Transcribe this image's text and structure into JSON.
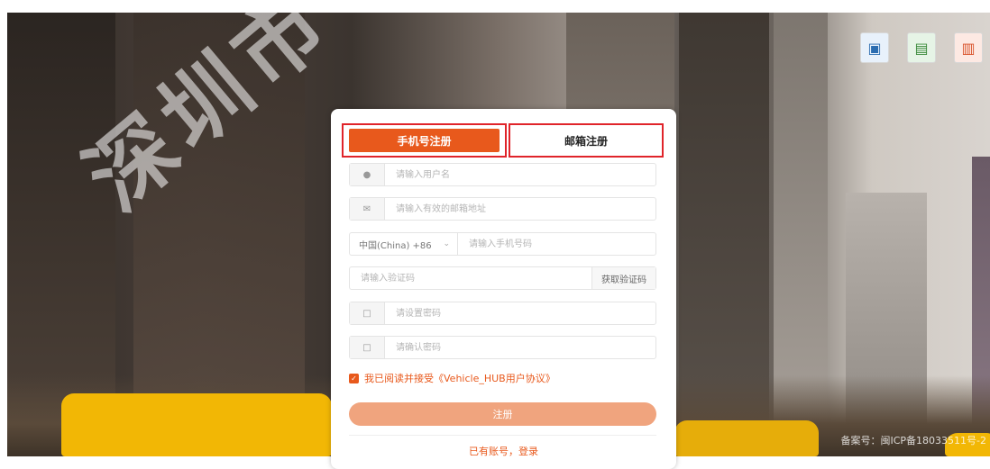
{
  "background": {
    "watermark": "深圳市",
    "footer_note": "备案号：闽ICP备18033511号-2"
  },
  "top_icons": [
    {
      "icon": "id-card-icon"
    },
    {
      "icon": "license-icon"
    },
    {
      "icon": "certificate-icon"
    }
  ],
  "tabs": {
    "phone": "手机号注册",
    "email": "邮箱注册"
  },
  "form": {
    "username_placeholder": "请输入用户名",
    "email_placeholder": "请输入有效的邮箱地址",
    "country_code": "中国(China)  +86",
    "phone_placeholder": "请输入手机号码",
    "code_placeholder": "请输入验证码",
    "get_code": "获取验证码",
    "password_placeholder": "请设置密码",
    "confirm_placeholder": "请确认密码"
  },
  "agreement": {
    "text": "我已阅读并接受",
    "link": "《Vehicle_HUB用户协议》"
  },
  "submit_label": "注册",
  "login_link": "已有账号，登录",
  "colors": {
    "accent": "#e8591c",
    "highlight": "#e0242a",
    "button": "#f0a47e"
  }
}
